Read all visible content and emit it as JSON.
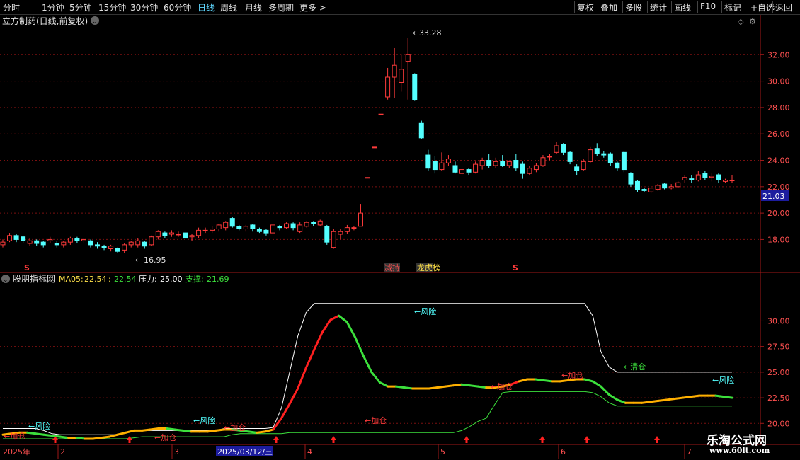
{
  "toolbar": {
    "timeframes": [
      "分时",
      "1分钟",
      "5分钟",
      "15分钟",
      "30分钟",
      "60分钟",
      "日线",
      "周线",
      "月线",
      "多周期",
      "更多 >"
    ],
    "active_timeframe": "日线",
    "right_tools": [
      "复权",
      "叠加",
      "多股",
      "统计",
      "画线",
      "F10",
      "标记",
      "+自选",
      "返回"
    ]
  },
  "main_panel": {
    "title": "立方制药(日线,前复权)",
    "current_price_tag": "21.03",
    "high_label": "33.28",
    "low_label": "16.95",
    "event_labels": [
      "S",
      "减持",
      "龙虎榜",
      "S"
    ]
  },
  "indicator_panel": {
    "title": "股朋指标网",
    "ma05_label": "MA05:",
    "ma05_value": "22.54",
    "ma05_value2": "22.54",
    "pressure_label": "压力:",
    "pressure_value": "25.00",
    "support_label": "支撑:",
    "support_value": "21.69",
    "annotations": [
      "←加仓",
      "←风险",
      "←加仓",
      "←风险",
      "←加仓",
      "←加仓",
      "←风险",
      "←加仓",
      "←加仓",
      "←清仓",
      "←风险"
    ]
  },
  "x_axis": {
    "labels": [
      "2025年",
      "2",
      "3",
      "2025/03/12/三",
      "4",
      "5",
      "6",
      "7"
    ]
  },
  "watermark": {
    "line1": "乐淘公式网",
    "line2": "www.60lt.com"
  },
  "colors": {
    "up": "#ff3b3b",
    "down": "#54ffff",
    "background": "#000000",
    "grid": "#7a1010",
    "axis": "#a01818"
  },
  "chart_data": [
    {
      "type": "candlestick",
      "title": "立方制药(日线,前复权)",
      "y_ticks": [
        18.0,
        20.0,
        22.0,
        24.0,
        26.0,
        28.0,
        30.0,
        32.0
      ],
      "ylim": [
        16.2,
        34.0
      ],
      "last_price": 21.03,
      "candles": [
        {
          "o": 17.6,
          "c": 17.8,
          "h": 18.0,
          "l": 17.4
        },
        {
          "o": 17.9,
          "c": 18.3,
          "h": 18.5,
          "l": 17.8
        },
        {
          "o": 18.3,
          "c": 18.0,
          "h": 18.4,
          "l": 17.8
        },
        {
          "o": 18.2,
          "c": 17.9,
          "h": 18.3,
          "l": 17.7
        },
        {
          "o": 17.7,
          "c": 17.9,
          "h": 18.1,
          "l": 17.5
        },
        {
          "o": 17.9,
          "c": 17.7,
          "h": 18.0,
          "l": 17.5
        },
        {
          "o": 17.8,
          "c": 17.6,
          "h": 17.9,
          "l": 17.4
        },
        {
          "o": 17.9,
          "c": 18.0,
          "h": 18.2,
          "l": 17.7
        },
        {
          "o": 17.7,
          "c": 17.6,
          "h": 17.9,
          "l": 17.4
        },
        {
          "o": 17.6,
          "c": 17.8,
          "h": 17.9,
          "l": 17.4
        },
        {
          "o": 17.8,
          "c": 18.1,
          "h": 18.2,
          "l": 17.6
        },
        {
          "o": 18.1,
          "c": 17.9,
          "h": 18.2,
          "l": 17.7
        },
        {
          "o": 17.9,
          "c": 18.0,
          "h": 18.1,
          "l": 17.7
        },
        {
          "o": 17.9,
          "c": 17.6,
          "h": 18.0,
          "l": 17.4
        },
        {
          "o": 17.6,
          "c": 17.5,
          "h": 17.8,
          "l": 17.3
        },
        {
          "o": 17.5,
          "c": 17.4,
          "h": 17.6,
          "l": 17.2
        },
        {
          "o": 17.3,
          "c": 17.5,
          "h": 17.6,
          "l": 17.1
        },
        {
          "o": 17.3,
          "c": 17.1,
          "h": 17.4,
          "l": 16.95
        },
        {
          "o": 17.2,
          "c": 17.6,
          "h": 17.7,
          "l": 17.0
        },
        {
          "o": 17.6,
          "c": 17.8,
          "h": 17.9,
          "l": 17.4
        },
        {
          "o": 17.6,
          "c": 17.9,
          "h": 18.1,
          "l": 17.4
        },
        {
          "o": 17.8,
          "c": 17.5,
          "h": 17.9,
          "l": 17.3
        },
        {
          "o": 17.6,
          "c": 18.2,
          "h": 18.3,
          "l": 17.5
        },
        {
          "o": 18.2,
          "c": 18.6,
          "h": 18.7,
          "l": 18.0
        },
        {
          "o": 18.5,
          "c": 18.3,
          "h": 18.6,
          "l": 18.1
        },
        {
          "o": 18.4,
          "c": 18.5,
          "h": 18.7,
          "l": 18.2
        },
        {
          "o": 18.4,
          "c": 18.4,
          "h": 18.6,
          "l": 18.2
        },
        {
          "o": 18.5,
          "c": 18.1,
          "h": 18.6,
          "l": 18.0
        },
        {
          "o": 18.2,
          "c": 18.3,
          "h": 18.4,
          "l": 17.9
        },
        {
          "o": 18.3,
          "c": 18.7,
          "h": 18.9,
          "l": 18.1
        },
        {
          "o": 18.7,
          "c": 18.7,
          "h": 18.9,
          "l": 18.5
        },
        {
          "o": 18.7,
          "c": 18.8,
          "h": 19.0,
          "l": 18.5
        },
        {
          "o": 18.8,
          "c": 19.1,
          "h": 19.2,
          "l": 18.6
        },
        {
          "o": 18.9,
          "c": 19.3,
          "h": 19.4,
          "l": 18.7
        },
        {
          "o": 19.6,
          "c": 19.0,
          "h": 19.7,
          "l": 18.9
        },
        {
          "o": 19.0,
          "c": 18.8,
          "h": 19.1,
          "l": 18.7
        },
        {
          "o": 18.8,
          "c": 19.0,
          "h": 19.1,
          "l": 18.6
        },
        {
          "o": 19.1,
          "c": 18.8,
          "h": 19.2,
          "l": 18.6
        },
        {
          "o": 18.8,
          "c": 18.6,
          "h": 18.9,
          "l": 18.5
        },
        {
          "o": 18.7,
          "c": 18.5,
          "h": 18.8,
          "l": 18.3
        },
        {
          "o": 18.5,
          "c": 19.1,
          "h": 19.2,
          "l": 18.4
        },
        {
          "o": 19.0,
          "c": 18.9,
          "h": 19.1,
          "l": 18.7
        },
        {
          "o": 18.9,
          "c": 19.2,
          "h": 19.3,
          "l": 18.8
        },
        {
          "o": 19.2,
          "c": 18.9,
          "h": 19.3,
          "l": 18.7
        },
        {
          "o": 18.6,
          "c": 19.1,
          "h": 19.3,
          "l": 18.5
        },
        {
          "o": 19.0,
          "c": 19.3,
          "h": 19.4,
          "l": 18.9
        },
        {
          "o": 19.3,
          "c": 19.2,
          "h": 19.4,
          "l": 19.0
        },
        {
          "o": 19.1,
          "c": 19.4,
          "h": 19.5,
          "l": 19.0
        },
        {
          "o": 19.0,
          "c": 17.8,
          "h": 19.1,
          "l": 17.6
        },
        {
          "o": 17.4,
          "c": 18.6,
          "h": 18.8,
          "l": 17.3
        },
        {
          "o": 18.4,
          "c": 18.6,
          "h": 18.8,
          "l": 18.0
        },
        {
          "o": 18.6,
          "c": 18.9,
          "h": 19.1,
          "l": 18.4
        },
        {
          "o": 18.9,
          "c": 18.9,
          "h": 19.0,
          "l": 18.7
        },
        {
          "o": 19.0,
          "c": 20.0,
          "h": 20.7,
          "l": 19.0
        },
        {
          "o": 22.7,
          "c": 22.7,
          "h": 22.7,
          "l": 22.7
        },
        {
          "o": 25.0,
          "c": 25.0,
          "h": 25.0,
          "l": 25.0
        },
        {
          "o": 27.5,
          "c": 27.5,
          "h": 27.5,
          "l": 27.5
        },
        {
          "o": 28.8,
          "c": 30.3,
          "h": 31.0,
          "l": 28.6
        },
        {
          "o": 30.3,
          "c": 31.2,
          "h": 32.5,
          "l": 28.7
        },
        {
          "o": 29.9,
          "c": 30.9,
          "h": 32.0,
          "l": 29.2
        },
        {
          "o": 31.5,
          "c": 32.0,
          "h": 33.28,
          "l": 28.6
        },
        {
          "o": 30.5,
          "c": 28.6,
          "h": 30.6,
          "l": 28.5
        },
        {
          "o": 26.8,
          "c": 25.7,
          "h": 27.0,
          "l": 25.6
        },
        {
          "o": 24.4,
          "c": 23.4,
          "h": 24.8,
          "l": 23.2
        },
        {
          "o": 23.9,
          "c": 23.3,
          "h": 24.3,
          "l": 23.0
        },
        {
          "o": 23.3,
          "c": 23.8,
          "h": 24.6,
          "l": 23.2
        },
        {
          "o": 23.8,
          "c": 24.1,
          "h": 24.4,
          "l": 23.6
        },
        {
          "o": 23.6,
          "c": 23.1,
          "h": 23.9,
          "l": 23.0
        },
        {
          "o": 23.0,
          "c": 23.3,
          "h": 23.6,
          "l": 22.8
        },
        {
          "o": 23.3,
          "c": 23.1,
          "h": 23.4,
          "l": 22.9
        },
        {
          "o": 23.1,
          "c": 23.7,
          "h": 23.9,
          "l": 23.0
        },
        {
          "o": 23.6,
          "c": 24.0,
          "h": 24.2,
          "l": 23.3
        },
        {
          "o": 24.0,
          "c": 23.6,
          "h": 24.5,
          "l": 23.4
        },
        {
          "o": 23.6,
          "c": 23.9,
          "h": 24.2,
          "l": 23.4
        },
        {
          "o": 23.9,
          "c": 23.6,
          "h": 24.4,
          "l": 23.5
        },
        {
          "o": 23.6,
          "c": 23.9,
          "h": 24.0,
          "l": 23.4
        },
        {
          "o": 24.0,
          "c": 23.4,
          "h": 24.5,
          "l": 23.2
        },
        {
          "o": 23.7,
          "c": 23.0,
          "h": 23.9,
          "l": 22.6
        },
        {
          "o": 23.0,
          "c": 23.4,
          "h": 23.6,
          "l": 22.9
        },
        {
          "o": 23.3,
          "c": 23.6,
          "h": 23.8,
          "l": 23.1
        },
        {
          "o": 23.6,
          "c": 24.2,
          "h": 24.4,
          "l": 23.5
        },
        {
          "o": 24.3,
          "c": 24.3,
          "h": 24.5,
          "l": 24.0
        },
        {
          "o": 24.6,
          "c": 25.1,
          "h": 25.4,
          "l": 24.5
        },
        {
          "o": 25.2,
          "c": 24.6,
          "h": 25.3,
          "l": 24.4
        },
        {
          "o": 24.6,
          "c": 23.9,
          "h": 24.7,
          "l": 23.7
        },
        {
          "o": 23.5,
          "c": 23.2,
          "h": 23.7,
          "l": 22.9
        },
        {
          "o": 23.3,
          "c": 23.9,
          "h": 24.1,
          "l": 23.2
        },
        {
          "o": 23.9,
          "c": 24.8,
          "h": 25.0,
          "l": 23.8
        },
        {
          "o": 24.9,
          "c": 24.5,
          "h": 25.3,
          "l": 24.3
        },
        {
          "o": 24.5,
          "c": 24.4,
          "h": 24.7,
          "l": 24.2
        },
        {
          "o": 24.5,
          "c": 23.8,
          "h": 24.6,
          "l": 23.6
        },
        {
          "o": 23.8,
          "c": 23.4,
          "h": 23.9,
          "l": 23.2
        },
        {
          "o": 24.6,
          "c": 23.3,
          "h": 24.7,
          "l": 23.1
        },
        {
          "o": 23.0,
          "c": 22.2,
          "h": 23.1,
          "l": 22.0
        },
        {
          "o": 22.4,
          "c": 21.8,
          "h": 22.5,
          "l": 21.6
        },
        {
          "o": 21.8,
          "c": 21.7,
          "h": 21.9,
          "l": 21.6
        },
        {
          "o": 21.6,
          "c": 21.9,
          "h": 22.0,
          "l": 21.5
        },
        {
          "o": 21.8,
          "c": 22.1,
          "h": 22.2,
          "l": 21.7
        },
        {
          "o": 22.2,
          "c": 21.9,
          "h": 22.3,
          "l": 21.8
        },
        {
          "o": 21.9,
          "c": 22.0,
          "h": 22.2,
          "l": 21.8
        },
        {
          "o": 22.0,
          "c": 22.3,
          "h": 22.4,
          "l": 21.9
        },
        {
          "o": 22.5,
          "c": 22.7,
          "h": 22.9,
          "l": 22.3
        },
        {
          "o": 22.6,
          "c": 22.5,
          "h": 22.9,
          "l": 22.3
        },
        {
          "o": 22.5,
          "c": 22.9,
          "h": 23.2,
          "l": 22.4
        },
        {
          "o": 23.0,
          "c": 22.7,
          "h": 23.2,
          "l": 22.5
        },
        {
          "o": 22.7,
          "c": 22.8,
          "h": 23.0,
          "l": 22.4
        },
        {
          "o": 22.9,
          "c": 22.5,
          "h": 23.0,
          "l": 22.3
        },
        {
          "o": 22.4,
          "c": 22.5,
          "h": 22.6,
          "l": 22.3
        },
        {
          "o": 22.5,
          "c": 22.5,
          "h": 22.9,
          "l": 22.3
        }
      ]
    },
    {
      "type": "line",
      "title": "股朋指标网",
      "y_ticks": [
        20.0,
        22.5,
        25.0,
        27.5,
        30.0
      ],
      "ylim": [
        18.5,
        33.0
      ],
      "series": [
        {
          "name": "MA05",
          "values": [
            18.9,
            19.0,
            19.1,
            19.1,
            19.0,
            18.9,
            18.8,
            18.7,
            18.6,
            18.6,
            18.5,
            18.5,
            18.6,
            18.7,
            18.9,
            19.1,
            19.3,
            19.3,
            19.4,
            19.5,
            19.5,
            19.4,
            19.3,
            19.2,
            19.2,
            19.2,
            19.3,
            19.4,
            19.4,
            19.3,
            19.2,
            19.1,
            19.2,
            19.4,
            20.5,
            21.9,
            23.4,
            25.4,
            27.2,
            28.9,
            30.1,
            30.5,
            29.9,
            28.4,
            26.6,
            25.0,
            24.0,
            23.6,
            23.6,
            23.5,
            23.4,
            23.4,
            23.4,
            23.5,
            23.6,
            23.7,
            23.8,
            23.7,
            23.6,
            23.5,
            23.5,
            23.6,
            23.8,
            24.1,
            24.3,
            24.3,
            24.2,
            24.1,
            24.1,
            24.2,
            24.3,
            24.3,
            24.1,
            23.6,
            22.8,
            22.3,
            22.0,
            22.0,
            22.0,
            22.1,
            22.2,
            22.3,
            22.4,
            22.5,
            22.6,
            22.7,
            22.7,
            22.7,
            22.6,
            22.5
          ]
        },
        {
          "name": "压力",
          "values": [
            19.5,
            19.5,
            19.5,
            19.5,
            19.5,
            19.3,
            19.0,
            18.9,
            18.9,
            18.9,
            18.9,
            18.9,
            18.9,
            18.9,
            18.9,
            19.1,
            19.3,
            19.3,
            19.3,
            19.3,
            19.3,
            19.3,
            19.3,
            19.3,
            19.3,
            19.3,
            19.3,
            19.5,
            19.5,
            19.5,
            19.5,
            19.5,
            19.5,
            19.6,
            21.5,
            25.0,
            28.5,
            30.8,
            31.7,
            31.7,
            31.7,
            31.7,
            31.7,
            31.7,
            31.7,
            31.7,
            31.7,
            31.7,
            31.7,
            31.7,
            31.7,
            31.7,
            31.7,
            31.7,
            31.7,
            31.7,
            31.7,
            31.7,
            31.7,
            31.7,
            31.7,
            31.7,
            31.7,
            31.7,
            31.7,
            31.7,
            31.7,
            31.7,
            31.7,
            31.7,
            31.7,
            31.7,
            30.5,
            27.0,
            25.5,
            25.0,
            25.0,
            25.0,
            25.0,
            25.0,
            25.0,
            25.0,
            25.0,
            25.0,
            25.0,
            25.0,
            25.0,
            25.0,
            25.0,
            25.0
          ]
        },
        {
          "name": "支撑",
          "values": [
            18.5,
            18.5,
            18.5,
            18.5,
            18.5,
            18.5,
            18.5,
            18.5,
            18.5,
            18.5,
            18.5,
            18.5,
            18.5,
            18.5,
            18.5,
            18.5,
            18.6,
            18.7,
            18.7,
            18.7,
            18.7,
            18.7,
            18.7,
            18.7,
            18.7,
            18.7,
            18.7,
            18.7,
            18.9,
            19.0,
            19.0,
            19.0,
            19.0,
            19.0,
            19.0,
            19.1,
            19.1,
            19.1,
            19.1,
            19.1,
            19.1,
            19.1,
            19.1,
            19.1,
            19.1,
            19.1,
            19.1,
            19.1,
            19.1,
            19.1,
            19.1,
            19.1,
            19.1,
            19.1,
            19.1,
            19.1,
            19.3,
            19.7,
            20.2,
            20.5,
            21.8,
            23.0,
            23.1,
            23.1,
            23.1,
            23.1,
            23.1,
            23.1,
            23.1,
            23.1,
            23.1,
            23.1,
            23.0,
            22.6,
            22.0,
            21.7,
            21.7,
            21.7,
            21.7,
            21.7,
            21.7,
            21.7,
            21.7,
            21.7,
            21.7,
            21.7,
            21.7,
            21.7,
            21.7,
            21.7
          ]
        }
      ]
    }
  ]
}
